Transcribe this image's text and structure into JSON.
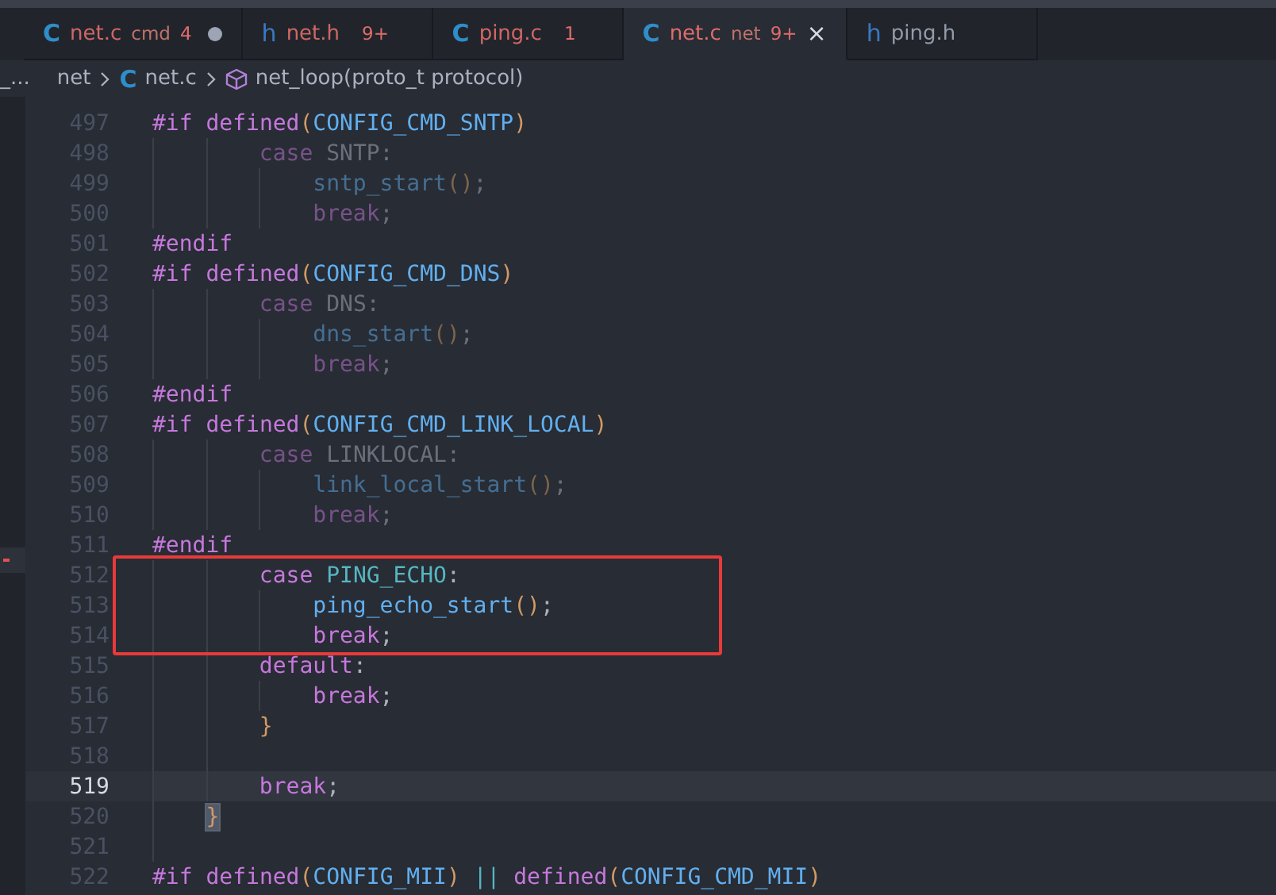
{
  "tabs": [
    {
      "icon": "C",
      "label": "net.c",
      "description": "cmd",
      "badge": "4",
      "has_errors": true,
      "dirty": true,
      "selected": false
    },
    {
      "icon": "h",
      "label": "net.h",
      "badge": "9+",
      "has_errors": true,
      "dirty": false,
      "selected": false
    },
    {
      "icon": "C",
      "label": "ping.c",
      "badge": "1",
      "has_errors": true,
      "dirty": false,
      "selected": false
    },
    {
      "icon": "C",
      "label": "net.c",
      "description": "net",
      "badge": "9+",
      "has_errors": true,
      "dirty": false,
      "selected": true,
      "close": "×"
    },
    {
      "icon": "h",
      "label": "ping.h",
      "has_errors": false,
      "dirty": false,
      "selected": false
    }
  ],
  "breadcrumb": {
    "overflow": "_...",
    "items": [
      {
        "kind": "folder",
        "label": "net"
      },
      {
        "kind": "file",
        "icon": "C",
        "label": "net.c"
      },
      {
        "kind": "symbol",
        "label": "net_loop(proto_t protocol)"
      }
    ]
  },
  "code_blocks": [
    {
      "kind": "plain",
      "lines": [
        {
          "number": "497",
          "inactive": false,
          "current": false,
          "tokens": [
            {
              "kind": "keyword",
              "text": "#if"
            },
            {
              "kind": "keyword",
              "text": " defined"
            },
            {
              "kind": "paren",
              "text": "("
            },
            {
              "kind": "macro",
              "text": "CONFIG_CMD_SNTP"
            },
            {
              "kind": "paren",
              "text": ")"
            }
          ]
        },
        {
          "number": "498",
          "inactive": true,
          "current": false,
          "tokens": [
            {
              "kind": "keyword",
              "text": "        case"
            },
            {
              "kind": "plain",
              "text": " SNTP:"
            }
          ]
        },
        {
          "number": "499",
          "inactive": true,
          "current": false,
          "tokens": [
            {
              "kind": "function",
              "text": "            sntp_start"
            },
            {
              "kind": "paren",
              "text": "()"
            },
            {
              "kind": "plain",
              "text": ";"
            }
          ]
        },
        {
          "number": "500",
          "inactive": true,
          "current": false,
          "tokens": [
            {
              "kind": "keyword",
              "text": "            break"
            },
            {
              "kind": "plain",
              "text": ";"
            }
          ]
        },
        {
          "number": "501",
          "inactive": false,
          "current": false,
          "tokens": [
            {
              "kind": "keyword",
              "text": "#endif"
            }
          ]
        },
        {
          "number": "502",
          "inactive": false,
          "current": false,
          "tokens": [
            {
              "kind": "keyword",
              "text": "#if"
            },
            {
              "kind": "keyword",
              "text": " defined"
            },
            {
              "kind": "paren",
              "text": "("
            },
            {
              "kind": "macro",
              "text": "CONFIG_CMD_DNS"
            },
            {
              "kind": "paren",
              "text": ")"
            }
          ]
        },
        {
          "number": "503",
          "inactive": true,
          "current": false,
          "tokens": [
            {
              "kind": "keyword",
              "text": "        case"
            },
            {
              "kind": "plain",
              "text": " DNS:"
            }
          ]
        },
        {
          "number": "504",
          "inactive": true,
          "current": false,
          "tokens": [
            {
              "kind": "function",
              "text": "            dns_start"
            },
            {
              "kind": "paren",
              "text": "()"
            },
            {
              "kind": "plain",
              "text": ";"
            }
          ]
        },
        {
          "number": "505",
          "inactive": true,
          "current": false,
          "tokens": [
            {
              "kind": "keyword",
              "text": "            break"
            },
            {
              "kind": "plain",
              "text": ";"
            }
          ]
        },
        {
          "number": "506",
          "inactive": false,
          "current": false,
          "tokens": [
            {
              "kind": "keyword",
              "text": "#endif"
            }
          ]
        },
        {
          "number": "507",
          "inactive": false,
          "current": false,
          "tokens": [
            {
              "kind": "keyword",
              "text": "#if"
            },
            {
              "kind": "keyword",
              "text": " defined"
            },
            {
              "kind": "paren",
              "text": "("
            },
            {
              "kind": "macro",
              "text": "CONFIG_CMD_LINK_LOCAL"
            },
            {
              "kind": "paren",
              "text": ")"
            }
          ]
        },
        {
          "number": "508",
          "inactive": true,
          "current": false,
          "tokens": [
            {
              "kind": "keyword",
              "text": "        case"
            },
            {
              "kind": "plain",
              "text": " LINKLOCAL:"
            }
          ]
        },
        {
          "number": "509",
          "inactive": true,
          "current": false,
          "tokens": [
            {
              "kind": "function",
              "text": "            link_local_start"
            },
            {
              "kind": "paren",
              "text": "()"
            },
            {
              "kind": "plain",
              "text": ";"
            }
          ]
        },
        {
          "number": "510",
          "inactive": true,
          "current": false,
          "tokens": [
            {
              "kind": "keyword",
              "text": "            break"
            },
            {
              "kind": "plain",
              "text": ";"
            }
          ]
        },
        {
          "number": "511",
          "inactive": false,
          "current": false,
          "tokens": [
            {
              "kind": "keyword",
              "text": "#endif"
            }
          ]
        }
      ]
    },
    {
      "kind": "boxed",
      "lines": [
        {
          "number": "512",
          "inactive": false,
          "current": false,
          "tokens": [
            {
              "kind": "keyword",
              "text": "        case"
            },
            {
              "kind": "constant",
              "text": " PING_ECHO"
            },
            {
              "kind": "plain",
              "text": ":"
            }
          ]
        },
        {
          "number": "513",
          "inactive": false,
          "current": false,
          "tokens": [
            {
              "kind": "function",
              "text": "            ping_echo_start"
            },
            {
              "kind": "paren",
              "text": "()"
            },
            {
              "kind": "plain",
              "text": ";"
            }
          ]
        },
        {
          "number": "514",
          "inactive": false,
          "current": false,
          "tokens": [
            {
              "kind": "keyword",
              "text": "            break"
            },
            {
              "kind": "plain",
              "text": ";"
            }
          ]
        }
      ]
    },
    {
      "kind": "plain",
      "lines": [
        {
          "number": "515",
          "inactive": false,
          "current": false,
          "tokens": [
            {
              "kind": "keyword",
              "text": "        default"
            },
            {
              "kind": "plain",
              "text": ":"
            }
          ]
        },
        {
          "number": "516",
          "inactive": false,
          "current": false,
          "tokens": [
            {
              "kind": "keyword",
              "text": "            break"
            },
            {
              "kind": "plain",
              "text": ";"
            }
          ]
        },
        {
          "number": "517",
          "inactive": false,
          "current": false,
          "tokens": [
            {
              "kind": "paren",
              "text": "        }"
            }
          ]
        },
        {
          "number": "518",
          "current": false
        },
        {
          "number": "519",
          "inactive": false,
          "current": true,
          "tokens": [
            {
              "kind": "keyword",
              "text": "        break"
            },
            {
              "kind": "plain",
              "text": ";"
            }
          ]
        },
        {
          "number": "520",
          "inactive": false,
          "current": false,
          "tokens": [
            {
              "kind": "bracket-match",
              "text": "    }"
            }
          ]
        },
        {
          "number": "521",
          "current": false
        },
        {
          "number": "522",
          "inactive": false,
          "current": false,
          "tokens": [
            {
              "kind": "keyword",
              "text": "#if"
            },
            {
              "kind": "keyword",
              "text": " defined"
            },
            {
              "kind": "paren",
              "text": "("
            },
            {
              "kind": "macro",
              "text": "CONFIG_MII"
            },
            {
              "kind": "paren",
              "text": ")"
            },
            {
              "kind": "operator",
              "text": " ||"
            },
            {
              "kind": "keyword",
              "text": " defined"
            },
            {
              "kind": "paren",
              "text": "("
            },
            {
              "kind": "macro",
              "text": "CONFIG_CMD_MII"
            },
            {
              "kind": "paren",
              "text": ")"
            }
          ]
        }
      ]
    }
  ]
}
